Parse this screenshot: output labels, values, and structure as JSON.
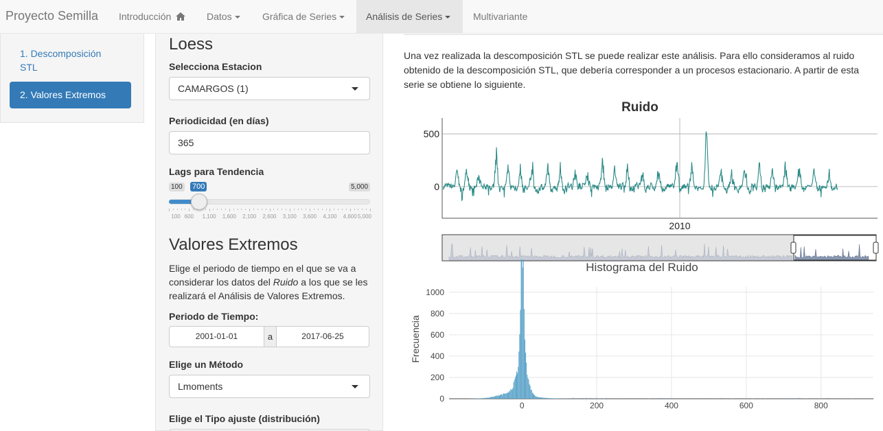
{
  "nav": {
    "brand": "Proyecto Semilla",
    "items": [
      {
        "label": "Introducción",
        "icon": "home-icon",
        "dropdown": false
      },
      {
        "label": "Datos",
        "dropdown": true
      },
      {
        "label": "Gráfica de Series",
        "dropdown": true
      },
      {
        "label": "Análisis de Series",
        "dropdown": true,
        "active": true
      },
      {
        "label": "Multivariante",
        "dropdown": false
      }
    ]
  },
  "sidebar": {
    "items": [
      {
        "label": "1. Descomposición STL",
        "active": false
      },
      {
        "label": "2. Valores Extremos",
        "active": true
      }
    ]
  },
  "controls": {
    "loess_heading": "Loess",
    "estacion_label": "Selecciona Estacion",
    "estacion_value": "CAMARGOS (1)",
    "periodicidad_label": "Periodicidad (en días)",
    "periodicidad_value": "365",
    "lags_label": "Lags para Tendencia",
    "lags_min": "100",
    "lags_value": "700",
    "lags_max": "5,000",
    "lags_ticks": [
      "100",
      "600",
      "1,100",
      "1,600",
      "2,100",
      "2,600",
      "3,100",
      "3,600",
      "4,100",
      "4,600",
      "5,000"
    ],
    "extremos_heading": "Valores Extremos",
    "extremos_text_1": "Elige el periodo de tiempo en el que se va a considerar los datos del ",
    "extremos_text_em": "Ruido",
    "extremos_text_2": " a los que se les realizará el Análisis de Valores Extremos.",
    "periodo_label": "Periodo de Tiempo:",
    "fecha_inicio": "2001-01-01",
    "fecha_sep": "a",
    "fecha_fin": "2017-06-25",
    "metodo_label": "Elige un Método",
    "metodo_value": "Lmoments",
    "ajuste_label": "Elige el Tipo ajuste (distribución)"
  },
  "main": {
    "intro": "Una vez realizada la descomposición STL se puede realizar este análisis. Para ello consideramos al ruido obtenido de la descomposición STL, que debería corresponder a un procesos estacionario. A partir de esta serie se obtiene lo siguiente."
  },
  "chart_data": [
    {
      "type": "line",
      "title": "Ruido",
      "x_tick_labels": [
        "2010"
      ],
      "y_tick_labels": [
        "0",
        "500"
      ],
      "ylim": [
        -300,
        650
      ],
      "grid": true,
      "series_color": "#2a8a86",
      "range_selector": true
    },
    {
      "type": "bar",
      "title": "Histograma del Ruido",
      "ylabel": "Frecuencia",
      "x_tick_labels": [
        "0",
        "200",
        "400",
        "600",
        "800"
      ],
      "y_tick_labels": [
        "0",
        "200",
        "400",
        "600",
        "800",
        "1000"
      ],
      "xlim": [
        -195,
        940
      ],
      "ylim": [
        0,
        1050
      ],
      "bin_width": 2,
      "bar_color": "#5ba3c9",
      "peaks": [
        {
          "x": -40,
          "y": 80
        },
        {
          "x": -20,
          "y": 160
        },
        {
          "x": -10,
          "y": 250
        },
        {
          "x": -5,
          "y": 380
        },
        {
          "x": -2,
          "y": 700
        },
        {
          "x": 0,
          "y": 1000
        },
        {
          "x": 3,
          "y": 980
        },
        {
          "x": 6,
          "y": 750
        },
        {
          "x": 10,
          "y": 430
        },
        {
          "x": 15,
          "y": 200
        },
        {
          "x": 25,
          "y": 90
        },
        {
          "x": 50,
          "y": 20
        },
        {
          "x": 100,
          "y": 5
        }
      ]
    }
  ]
}
